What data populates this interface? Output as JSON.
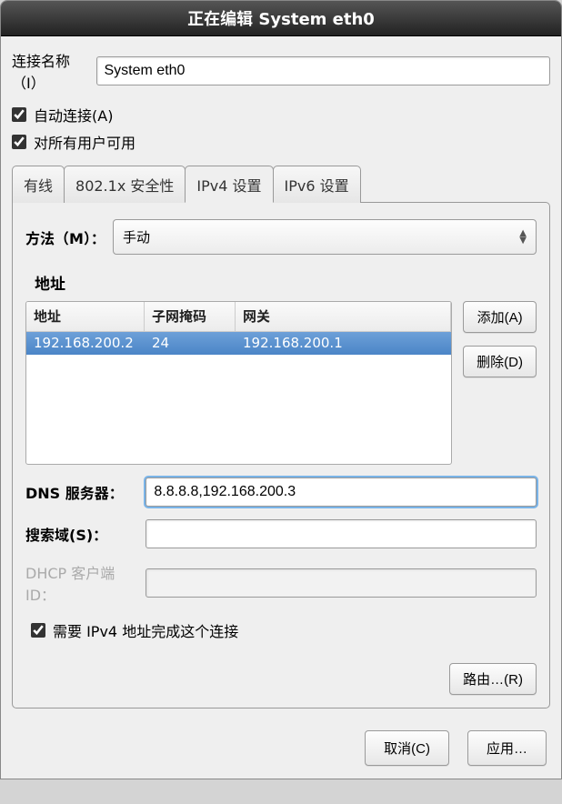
{
  "window": {
    "title": "正在编辑 System eth0"
  },
  "conn": {
    "name_label": "连接名称（I）",
    "name_value": "System eth0",
    "auto_label": "自动连接(A)",
    "allusers_label": "对所有用户可用"
  },
  "tabs": {
    "wired": "有线",
    "security": "802.1x 安全性",
    "ipv4": "IPv4 设置",
    "ipv6": "IPv6 设置"
  },
  "ipv4": {
    "method_label": "方法（M）：",
    "method_value": "手动",
    "addresses_title": "地址",
    "addr_head_addr": "地址",
    "addr_head_mask": "子网掩码",
    "addr_head_gw": "网关",
    "addr_row": {
      "addr": "192.168.200.2",
      "mask": "24",
      "gw": "192.168.200.1"
    },
    "btn_add": "添加(A)",
    "btn_del": "删除(D)",
    "dns_label": "DNS 服务器：",
    "dns_value": "8.8.8.8,192.168.200.3",
    "search_label": "搜索域(S)：",
    "search_value": "",
    "dhcp_label": "DHCP 客户端 ID：",
    "dhcp_value": "",
    "require_label": "需要 IPv4 地址完成这个连接",
    "routes_btn": "路由…(R)"
  },
  "footer": {
    "cancel": "取消(C)",
    "apply": "应用…"
  }
}
